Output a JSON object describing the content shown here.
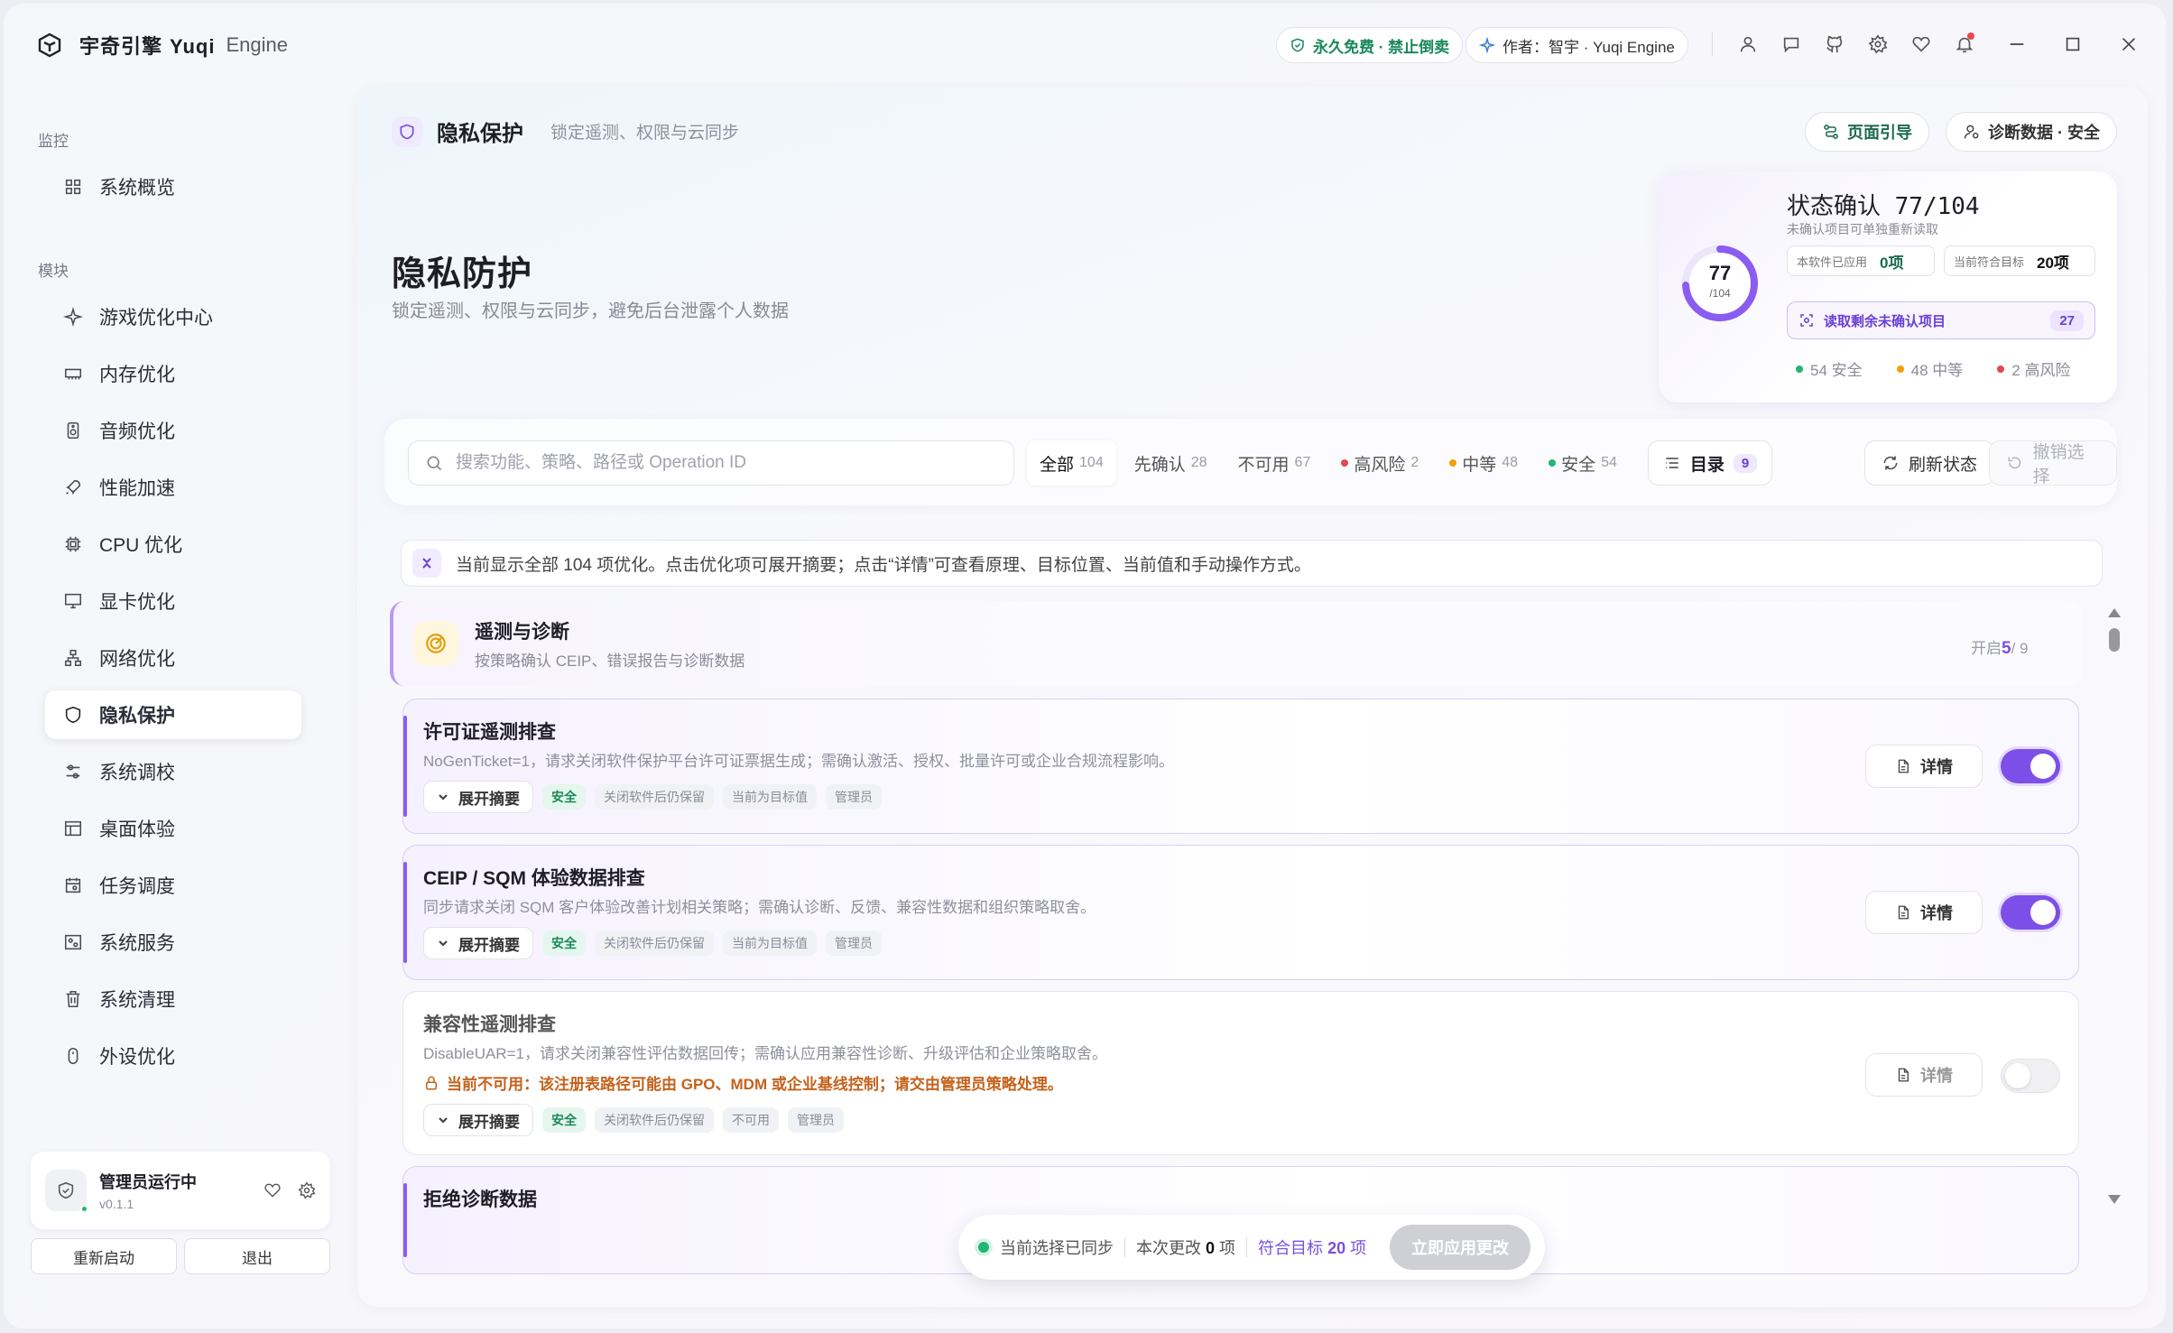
{
  "app": {
    "name": "宇奇引擎",
    "name_en": "Yuqi",
    "engine": "Engine"
  },
  "titlebar": {
    "free_pill": "永久免费 · 禁止倒卖",
    "author_pill": "作者：智宇 · Yuqi Engine",
    "icons": [
      "user-icon",
      "message-icon",
      "github-icon",
      "gear-icon",
      "heart-icon",
      "bell-icon"
    ],
    "window_controls": [
      "minimize",
      "maximize",
      "close"
    ]
  },
  "sidebar": {
    "section_monitor": "监控",
    "section_modules": "模块",
    "overview": "系统概览",
    "items": [
      {
        "label": "游戏优化中心",
        "icon": "sparkle-icon"
      },
      {
        "label": "内存优化",
        "icon": "memory-icon"
      },
      {
        "label": "音频优化",
        "icon": "speaker-icon"
      },
      {
        "label": "性能加速",
        "icon": "rocket-icon"
      },
      {
        "label": "CPU 优化",
        "icon": "cpu-icon"
      },
      {
        "label": "显卡优化",
        "icon": "monitor-icon"
      },
      {
        "label": "网络优化",
        "icon": "network-icon"
      },
      {
        "label": "隐私保护",
        "icon": "shield-icon",
        "active": true
      },
      {
        "label": "系统调校",
        "icon": "sliders-icon"
      },
      {
        "label": "桌面体验",
        "icon": "layout-icon"
      },
      {
        "label": "任务调度",
        "icon": "calendar-icon"
      },
      {
        "label": "系统服务",
        "icon": "services-icon"
      },
      {
        "label": "系统清理",
        "icon": "trash-icon"
      },
      {
        "label": "外设优化",
        "icon": "mouse-icon"
      }
    ],
    "admin": {
      "title": "管理员运行中",
      "version": "v0.1.1"
    },
    "restart_label": "重新启动",
    "exit_label": "退出"
  },
  "page": {
    "crumb_title": "隐私保护",
    "crumb_sub": "锁定遥测、权限与云同步",
    "guide_label": "页面引导",
    "diag_label": "诊断数据 · 安全",
    "hero_title": "隐私防护",
    "hero_sub": "锁定遥测、权限与云同步，避免后台泄露个人数据"
  },
  "status": {
    "title": "状态确认 77/104",
    "sub": "未确认项目可单独重新读取",
    "ring_num": "77",
    "ring_den": "/104",
    "ring_fraction": 0.74,
    "applied_label": "本软件已应用",
    "applied_value": "0项",
    "target_label": "当前符合目标",
    "target_value": "20项",
    "read_label": "读取剩余未确认项目",
    "read_count": "27",
    "legend": [
      {
        "label": "54 安全",
        "color": "#22b573"
      },
      {
        "label": "48 中等",
        "color": "#f59e0b"
      },
      {
        "label": "2 高风险",
        "color": "#e5484d"
      }
    ]
  },
  "toolbar": {
    "search_placeholder": "搜索功能、策略、路径或 Operation ID",
    "filters": [
      {
        "label": "全部",
        "count": "104",
        "active": true
      },
      {
        "label": "先确认",
        "count": "28"
      },
      {
        "label": "不可用",
        "count": "67"
      },
      {
        "label": "高风险",
        "count": "2",
        "dot": "#e5484d"
      },
      {
        "label": "中等",
        "count": "48",
        "dot": "#f59e0b"
      },
      {
        "label": "安全",
        "count": "54",
        "dot": "#22b573"
      }
    ],
    "toc_label": "目录",
    "toc_count": "9",
    "refresh_label": "刷新状态",
    "undo_label": "撤销选择"
  },
  "notice": "当前显示全部 104 项优化。点击优化项可展开摘要；点击“详情”可查看原理、目标位置、当前值和手动操作方式。",
  "group": {
    "title": "遥测与诊断",
    "sub": "按策略确认 CEIP、错误报告与诊断数据",
    "count_prefix": "开启",
    "count_on": "5",
    "count_total": "/ 9"
  },
  "items": [
    {
      "title": "许可证遥测排查",
      "desc": "NoGenTicket=1，请求关闭软件保护平台许可证票据生成；需确认激活、授权、批量许可或企业合规流程影响。",
      "expand": "展开摘要",
      "tags": [
        "安全",
        "关闭软件后仍保留",
        "当前为目标值",
        "管理员"
      ],
      "detail": "详情",
      "enabled": true
    },
    {
      "title": "CEIP / SQM 体验数据排查",
      "desc": "同步请求关闭 SQM 客户体验改善计划相关策略；需确认诊断、反馈、兼容性数据和组织策略取舍。",
      "expand": "展开摘要",
      "tags": [
        "安全",
        "关闭软件后仍保留",
        "当前为目标值",
        "管理员"
      ],
      "detail": "详情",
      "enabled": true
    },
    {
      "title": "兼容性遥测排查",
      "desc": "DisableUAR=1，请求关闭兼容性评估数据回传；需确认应用兼容性诊断、升级评估和企业策略取舍。",
      "warn": "当前不可用：该注册表路径可能由 GPO、MDM 或企业基线控制；请交由管理员策略处理。",
      "expand": "展开摘要",
      "tags": [
        "安全",
        "关闭软件后仍保留",
        "不可用",
        "管理员"
      ],
      "detail": "详情",
      "enabled": false
    },
    {
      "title": "拒绝诊断数据"
    }
  ],
  "bottom": {
    "synced": "当前选择已同步",
    "changes_prefix": "本次更改",
    "changes_value": "0",
    "changes_unit": "项",
    "target_prefix": "符合目标",
    "target_value": "20",
    "target_unit": "项",
    "apply_label": "立即应用更改"
  }
}
